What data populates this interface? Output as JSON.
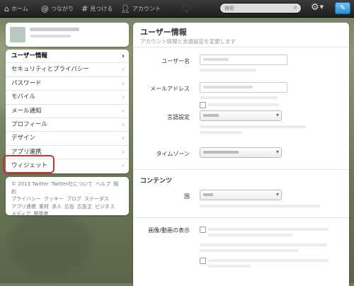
{
  "topbar": {
    "home": "ホーム",
    "connect": "つながり",
    "discover": "見つける",
    "account": "アカウント",
    "search_placeholder": "検索"
  },
  "left_menu": {
    "items": [
      {
        "label": "ユーザー情報",
        "active": true
      },
      {
        "label": "セキュリティとプライバシー"
      },
      {
        "label": "パスワード"
      },
      {
        "label": "モバイル"
      },
      {
        "label": "メール通知"
      },
      {
        "label": "プロフィール"
      },
      {
        "label": "デザイン"
      },
      {
        "label": "アプリ連携"
      },
      {
        "label": "ウィジェット"
      }
    ]
  },
  "footer": {
    "line1": [
      "© 2013 Twitter",
      "Twitter社について",
      "ヘルプ",
      "規約"
    ],
    "line2": [
      "プライバシー",
      "クッキー",
      "ブログ",
      "ステータス"
    ],
    "line3": [
      "アプリ連携",
      "素材",
      "求人",
      "広告",
      "広告主",
      "ビジネス"
    ],
    "line4": [
      "メディア",
      "開発者"
    ]
  },
  "panel": {
    "title": "ユーザー情報",
    "subtitle": "アカウント情報と言語設定を変更します",
    "username_label": "ユーザー名",
    "email_label": "メールアドレス",
    "language_label": "言語設定",
    "timezone_label": "タイムゾーン",
    "content_section": "コンテンツ",
    "country_label": "国",
    "media_label": "画像/動画の表示"
  },
  "colors": {
    "accent": "#2a8ed3",
    "highlight_ring": "#d2302c"
  }
}
